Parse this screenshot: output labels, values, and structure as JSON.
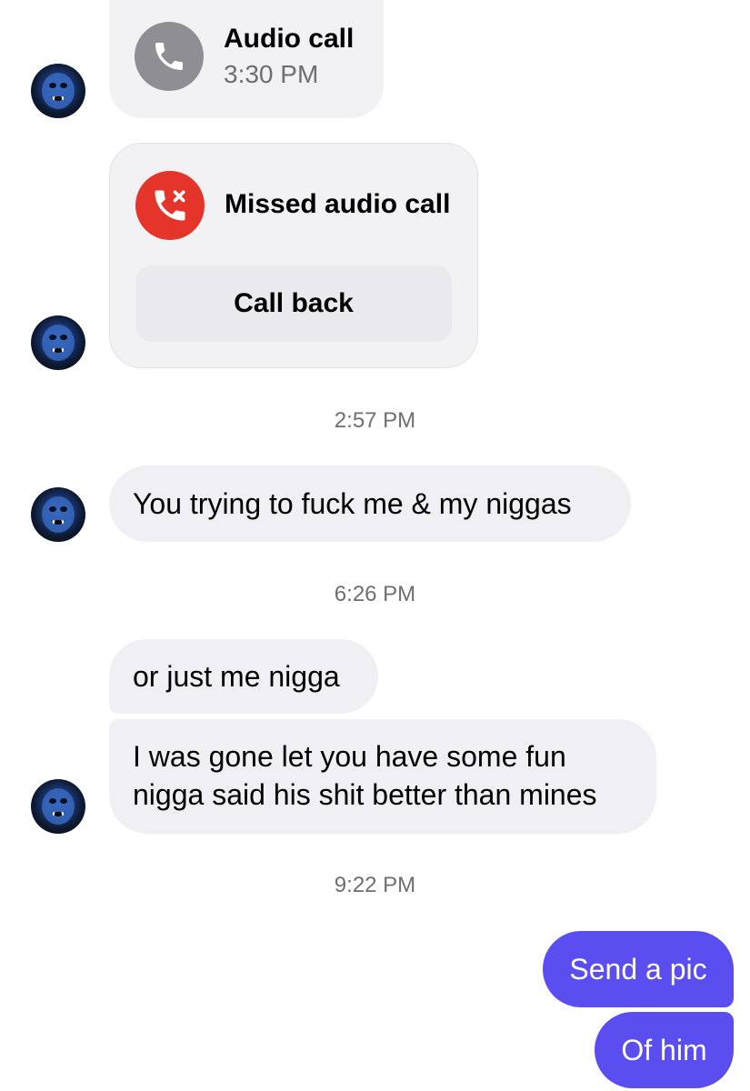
{
  "calls": {
    "audio": {
      "title": "Audio call",
      "time": "3:30 PM",
      "icon": "phone-icon"
    },
    "missed": {
      "title": "Missed audio call",
      "action": "Call back",
      "icon": "missed-call-icon"
    }
  },
  "timestamps": [
    "2:57 PM",
    "6:26 PM",
    "9:22 PM"
  ],
  "messages": {
    "in1": "You trying to fuck me & my niggas",
    "in2": "or just me nigga",
    "in3_line1": "I was gone let you have some fun",
    "in3_line2": "nigga said his shit better than mines",
    "out1": "Send a pic",
    "out2": "Of him"
  },
  "colors": {
    "outgoing_bubble": "#5b4ef0",
    "incoming_bubble": "#f0f0f4",
    "missed_call_red": "#e5352b",
    "audio_call_grey": "#8e8e93"
  }
}
